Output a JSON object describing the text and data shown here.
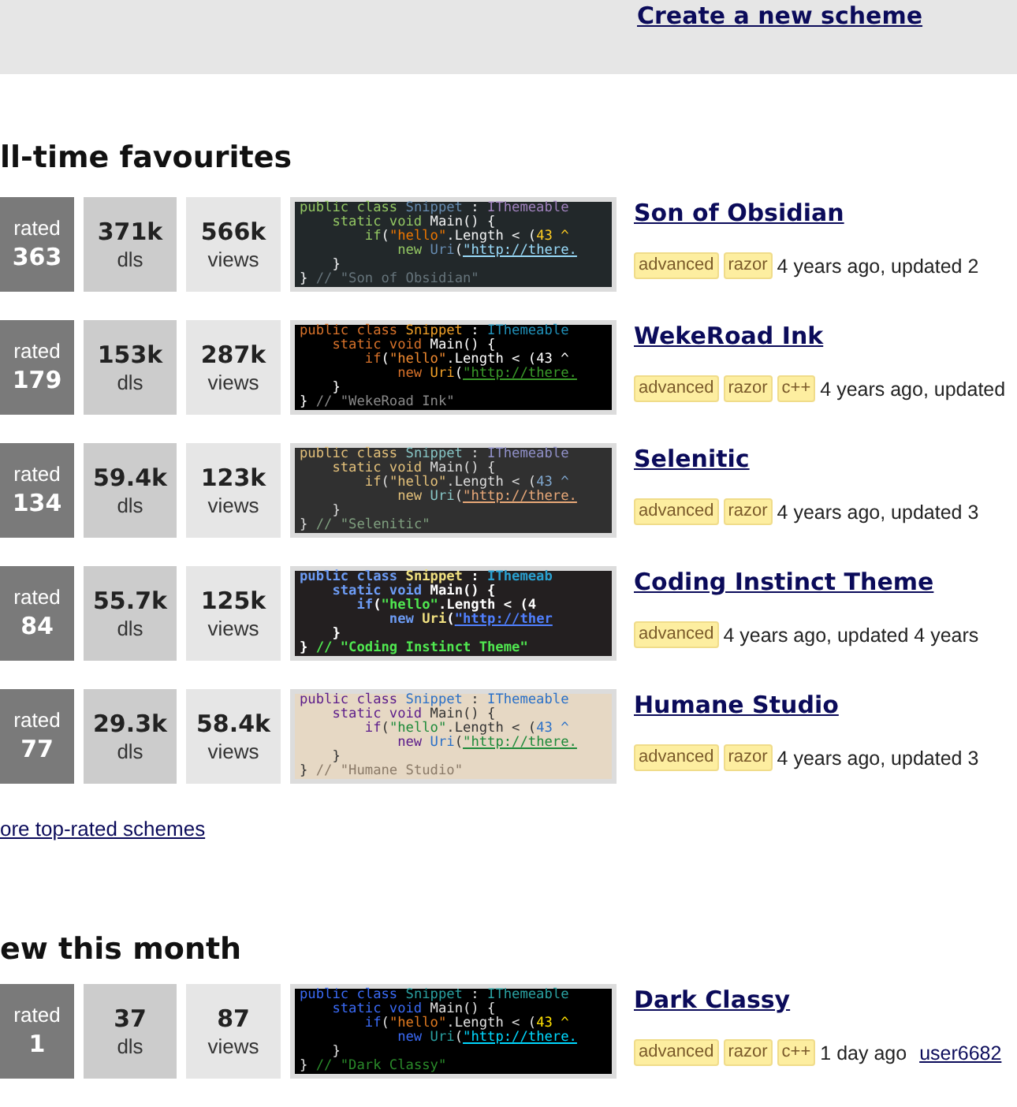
{
  "top_bar": {
    "create_link": "Create a new scheme"
  },
  "sections": [
    {
      "heading": "ll-time favourites",
      "more_link": "ore top-rated schemes",
      "schemes": [
        {
          "rated_label": "rated",
          "rating": "363",
          "downloads": "371k",
          "downloads_label": "dls",
          "views": "566k",
          "views_label": "views",
          "title": "Son of Obsidian",
          "tags": [
            "advanced",
            "razor"
          ],
          "meta": "4 years ago, updated 2",
          "code_lines": [
            [
              {
                "text": "public class ",
                "kind": "kw"
              },
              {
                "text": "Snippet",
                "kind": "type"
              },
              {
                "text": " : ",
                "kind": "plain"
              },
              {
                "text": "IThemeable",
                "kind": "iface"
              }
            ],
            [
              {
                "text": "    static void ",
                "kind": "kw"
              },
              {
                "text": "Main() {",
                "kind": "plain"
              }
            ],
            [
              {
                "text": "        if",
                "kind": "kw"
              },
              {
                "text": "(",
                "kind": "plain"
              },
              {
                "text": "\"hello\"",
                "kind": "str"
              },
              {
                "text": ".Length < (",
                "kind": "plain"
              },
              {
                "text": "43 ^",
                "kind": "num"
              }
            ],
            [
              {
                "text": "            new ",
                "kind": "kw"
              },
              {
                "text": "Uri",
                "kind": "type"
              },
              {
                "text": "(",
                "kind": "plain"
              },
              {
                "text": "\"http://there.",
                "kind": "url"
              }
            ],
            [
              {
                "text": "    }",
                "kind": "plain"
              }
            ],
            [
              {
                "text": "} ",
                "kind": "plain"
              },
              {
                "text": "// \"Son of Obsidian\"",
                "kind": "comment"
              }
            ]
          ]
        },
        {
          "rated_label": "rated",
          "rating": "179",
          "downloads": "153k",
          "downloads_label": "dls",
          "views": "287k",
          "views_label": "views",
          "title": "WekeRoad Ink",
          "tags": [
            "advanced",
            "razor",
            "c++"
          ],
          "meta": "4 years ago, updated",
          "code_lines": [
            [
              {
                "text": "public class ",
                "kind": "kw"
              },
              {
                "text": "Snippet",
                "kind": "type"
              },
              {
                "text": " : ",
                "kind": "plain"
              },
              {
                "text": "IThemeable",
                "kind": "iface"
              }
            ],
            [
              {
                "text": "    static void ",
                "kind": "kw"
              },
              {
                "text": "Main() {",
                "kind": "plain"
              }
            ],
            [
              {
                "text": "        if",
                "kind": "kw"
              },
              {
                "text": "(",
                "kind": "plain"
              },
              {
                "text": "\"hello\"",
                "kind": "str"
              },
              {
                "text": ".Length < (",
                "kind": "plain"
              },
              {
                "text": "43 ^",
                "kind": "num"
              }
            ],
            [
              {
                "text": "            new ",
                "kind": "kw"
              },
              {
                "text": "Uri",
                "kind": "type"
              },
              {
                "text": "(",
                "kind": "plain"
              },
              {
                "text": "\"http://there.",
                "kind": "url"
              }
            ],
            [
              {
                "text": "    }",
                "kind": "plain"
              }
            ],
            [
              {
                "text": "} ",
                "kind": "plain"
              },
              {
                "text": "// \"WekeRoad Ink\"",
                "kind": "comment"
              }
            ]
          ]
        },
        {
          "rated_label": "rated",
          "rating": "134",
          "downloads": "59.4k",
          "downloads_label": "dls",
          "views": "123k",
          "views_label": "views",
          "title": "Selenitic",
          "tags": [
            "advanced",
            "razor"
          ],
          "meta": "4 years ago, updated 3",
          "code_lines": [
            [
              {
                "text": "public class ",
                "kind": "kw"
              },
              {
                "text": "Snippet",
                "kind": "type"
              },
              {
                "text": " : ",
                "kind": "plain"
              },
              {
                "text": "IThemeable",
                "kind": "iface"
              }
            ],
            [
              {
                "text": "    static void ",
                "kind": "kw"
              },
              {
                "text": "Main() {",
                "kind": "plain"
              }
            ],
            [
              {
                "text": "        if",
                "kind": "kw"
              },
              {
                "text": "(",
                "kind": "plain"
              },
              {
                "text": "\"hello\"",
                "kind": "str"
              },
              {
                "text": ".Length < (",
                "kind": "plain"
              },
              {
                "text": "43 ^",
                "kind": "num"
              }
            ],
            [
              {
                "text": "            new ",
                "kind": "kw"
              },
              {
                "text": "Uri",
                "kind": "type"
              },
              {
                "text": "(",
                "kind": "plain"
              },
              {
                "text": "\"http://there.",
                "kind": "url"
              }
            ],
            [
              {
                "text": "    }",
                "kind": "plain"
              }
            ],
            [
              {
                "text": "} ",
                "kind": "plain"
              },
              {
                "text": "// \"Selenitic\"",
                "kind": "comment"
              }
            ]
          ]
        },
        {
          "rated_label": "rated",
          "rating": "84",
          "downloads": "55.7k",
          "downloads_label": "dls",
          "views": "125k",
          "views_label": "views",
          "title": "Coding Instinct Theme",
          "tags": [
            "advanced"
          ],
          "meta": "4 years ago, updated 4 years",
          "code_lines": [
            [
              {
                "text": "public class ",
                "kind": "kw"
              },
              {
                "text": "Snippet",
                "kind": "type"
              },
              {
                "text": " : ",
                "kind": "plain"
              },
              {
                "text": "IThemeab",
                "kind": "iface"
              }
            ],
            [
              {
                "text": "    static void ",
                "kind": "kw"
              },
              {
                "text": "Main() {",
                "kind": "plain"
              }
            ],
            [
              {
                "text": "       if",
                "kind": "kw"
              },
              {
                "text": "(",
                "kind": "plain"
              },
              {
                "text": "\"hello\"",
                "kind": "str"
              },
              {
                "text": ".Length < (",
                "kind": "plain"
              },
              {
                "text": "4",
                "kind": "num"
              }
            ],
            [
              {
                "text": "           new ",
                "kind": "kw"
              },
              {
                "text": "Uri",
                "kind": "type"
              },
              {
                "text": "(",
                "kind": "plain"
              },
              {
                "text": "\"http://ther",
                "kind": "url"
              }
            ],
            [
              {
                "text": "    }",
                "kind": "plain"
              }
            ],
            [
              {
                "text": "} ",
                "kind": "plain"
              },
              {
                "text": "// \"Coding Instinct Theme\"",
                "kind": "comment"
              }
            ]
          ]
        },
        {
          "rated_label": "rated",
          "rating": "77",
          "downloads": "29.3k",
          "downloads_label": "dls",
          "views": "58.4k",
          "views_label": "views",
          "title": "Humane Studio",
          "tags": [
            "advanced",
            "razor"
          ],
          "meta": "4 years ago, updated 3",
          "code_lines": [
            [
              {
                "text": "public class ",
                "kind": "kw"
              },
              {
                "text": "Snippet",
                "kind": "type"
              },
              {
                "text": " : ",
                "kind": "plain"
              },
              {
                "text": "IThemeable",
                "kind": "iface"
              }
            ],
            [
              {
                "text": "    static void ",
                "kind": "kw"
              },
              {
                "text": "Main() {",
                "kind": "plain"
              }
            ],
            [
              {
                "text": "        if",
                "kind": "kw"
              },
              {
                "text": "(",
                "kind": "plain"
              },
              {
                "text": "\"hello\"",
                "kind": "str"
              },
              {
                "text": ".Length < (",
                "kind": "plain"
              },
              {
                "text": "43 ^",
                "kind": "num"
              }
            ],
            [
              {
                "text": "            new ",
                "kind": "kw"
              },
              {
                "text": "Uri",
                "kind": "type"
              },
              {
                "text": "(",
                "kind": "plain"
              },
              {
                "text": "\"http://there.",
                "kind": "url"
              }
            ],
            [
              {
                "text": "    }",
                "kind": "plain"
              }
            ],
            [
              {
                "text": "} ",
                "kind": "plain"
              },
              {
                "text": "// \"Humane Studio\"",
                "kind": "comment"
              }
            ]
          ]
        }
      ]
    },
    {
      "heading": "ew this month",
      "schemes": [
        {
          "rated_label": "rated",
          "rating": "1",
          "downloads": "37",
          "downloads_label": "dls",
          "views": "87",
          "views_label": "views",
          "title": "Dark Classy",
          "tags": [
            "advanced",
            "razor",
            "c++"
          ],
          "meta": "1 day ago",
          "author": "user6682",
          "code_lines": [
            [
              {
                "text": "public class ",
                "kind": "kw"
              },
              {
                "text": "Snippet",
                "kind": "type"
              },
              {
                "text": " : ",
                "kind": "plain"
              },
              {
                "text": "IThemeable",
                "kind": "iface"
              }
            ],
            [
              {
                "text": "    static void ",
                "kind": "kw"
              },
              {
                "text": "Main() {",
                "kind": "plain"
              }
            ],
            [
              {
                "text": "        if",
                "kind": "kw"
              },
              {
                "text": "(",
                "kind": "plain"
              },
              {
                "text": "\"hello\"",
                "kind": "str"
              },
              {
                "text": ".Length < (",
                "kind": "plain"
              },
              {
                "text": "43 ^",
                "kind": "num"
              }
            ],
            [
              {
                "text": "            new ",
                "kind": "kw"
              },
              {
                "text": "Uri",
                "kind": "type"
              },
              {
                "text": "(",
                "kind": "plain"
              },
              {
                "text": "\"http://there.",
                "kind": "url"
              }
            ],
            [
              {
                "text": "    }",
                "kind": "plain"
              }
            ],
            [
              {
                "text": "} ",
                "kind": "plain"
              },
              {
                "text": "// \"Dark Classy\"",
                "kind": "comment"
              }
            ]
          ]
        }
      ]
    }
  ]
}
